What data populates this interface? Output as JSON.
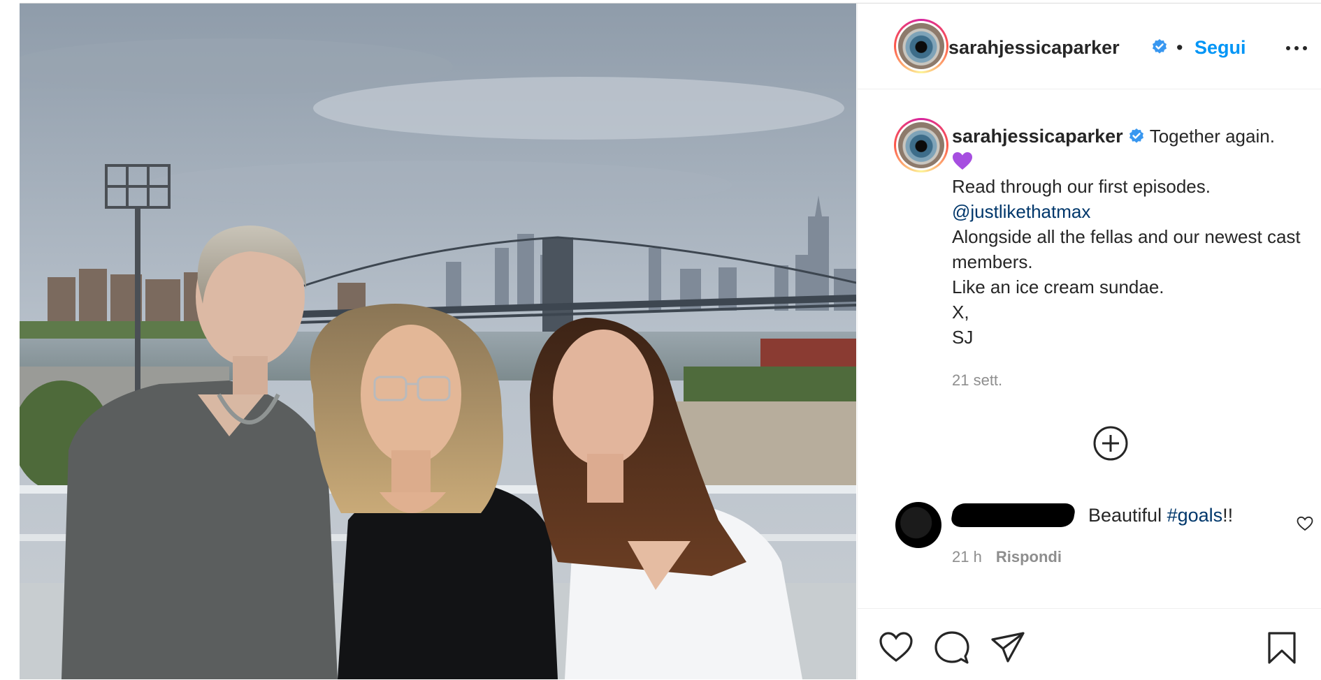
{
  "header": {
    "username": "sarahjessicaparker",
    "separator": "•",
    "follow_label": "Segui",
    "icons": {
      "verified": "verified-badge-icon",
      "more": "more-options-icon"
    }
  },
  "caption": {
    "username": "sarahjessicaparker",
    "first_line": "Together again.",
    "emoji": "purple-heart",
    "line_read": "Read through our first episodes.",
    "mention": "@justlikethatmax",
    "line_alongside": "Alongside all the fellas and our newest cast members.",
    "line_icecream": "Like an ice cream sundae.",
    "line_x": "X,",
    "line_sj": "SJ",
    "timestamp": "21 sett."
  },
  "comments": [
    {
      "username_redacted": true,
      "text_before": "Beautiful ",
      "hashtag": "#goals",
      "text_after": "!!",
      "time": "21 h",
      "reply_label": "Rispondi"
    }
  ],
  "actions": {
    "icons": [
      "like-heart-icon",
      "comment-icon",
      "share-icon",
      "save-bookmark-icon"
    ]
  },
  "colors": {
    "accent": "#0095f6",
    "link": "#00376b",
    "verified": "#3897f0",
    "muted": "#8e8e8e",
    "text": "#262626",
    "emoji_purple": "#a64ee0"
  }
}
